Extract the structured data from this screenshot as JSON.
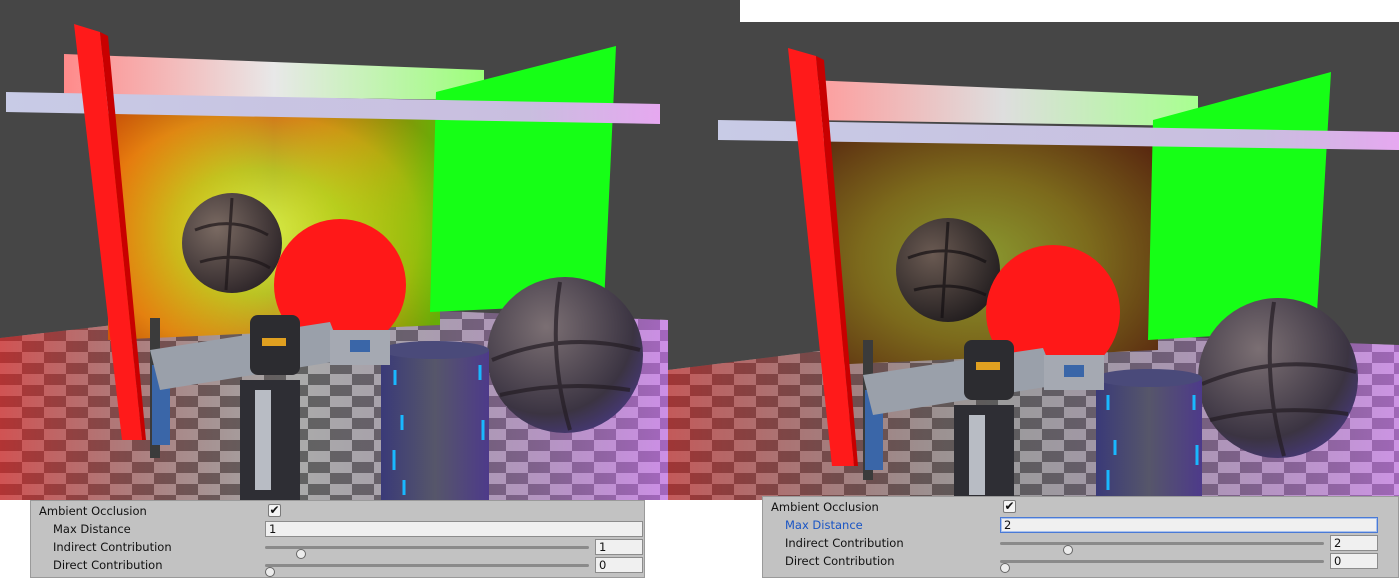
{
  "panels": [
    {
      "section_label": "Ambient Occlusion",
      "ambient_occlusion_checked": "✔",
      "max_distance_label": "Max Distance",
      "max_distance_value": "1",
      "indirect_label": "Indirect Contribution",
      "indirect_value": "1",
      "indirect_fraction": 0.1,
      "direct_label": "Direct Contribution",
      "direct_value": "0",
      "direct_fraction": 0.0
    },
    {
      "section_label": "Ambient Occlusion",
      "ambient_occlusion_checked": "✔",
      "max_distance_label": "Max Distance",
      "max_distance_value": "2",
      "indirect_label": "Indirect Contribution",
      "indirect_value": "2",
      "indirect_fraction": 0.2,
      "direct_label": "Direct Contribution",
      "direct_value": "0",
      "direct_fraction": 0.0
    }
  ],
  "colors": {
    "viewport_background": "#464646",
    "red_panel": "#ff1a1a",
    "green_panel": "#16ff16",
    "inspector_background": "#c2c2c2",
    "active_label": "#1a55c4"
  }
}
